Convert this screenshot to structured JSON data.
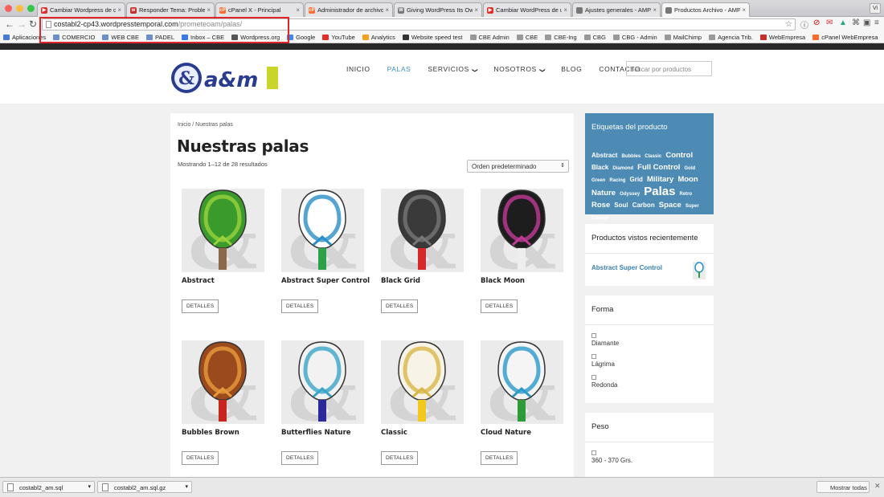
{
  "browser": {
    "tabs": [
      {
        "label": "Cambiar Wordpress de d",
        "color": "#e52d27",
        "glyph": "▶"
      },
      {
        "label": "Responder Tema: Problem",
        "color": "#c4302b",
        "glyph": "w"
      },
      {
        "label": "cPanel X - Principal",
        "color": "#ff6c2c",
        "glyph": "cP"
      },
      {
        "label": "Administrador de archivos",
        "color": "#ff6c2c",
        "glyph": "cP"
      },
      {
        "label": "Giving WordPress Its Own",
        "color": "#777777",
        "glyph": "W"
      },
      {
        "label": "Cambiar WordPress de un",
        "color": "#e52d27",
        "glyph": "▶"
      },
      {
        "label": "Ajustes generales - AMPAD",
        "color": "#777777",
        "glyph": ""
      },
      {
        "label": "Productos Archivo - AMPA",
        "color": "#777777",
        "glyph": ""
      }
    ],
    "profile": "Vi",
    "url_host": "costabl2-cp43.wordpresstemporal.com",
    "url_path": "/prometeoam/palas/",
    "bookmarks": [
      {
        "label": "Aplicaciones",
        "color": "#4a7bd0"
      },
      {
        "label": "COMERCIO",
        "color": "#6b8fc7"
      },
      {
        "label": "WEB CBE",
        "color": "#6b8fc7"
      },
      {
        "label": "PADEL",
        "color": "#6b8fc7"
      },
      {
        "label": "Inbox – CBE",
        "color": "#3b78e7"
      },
      {
        "label": "Wordpress.org",
        "color": "#555555"
      },
      {
        "label": "Google",
        "color": "#4285f4"
      },
      {
        "label": "YouTube",
        "color": "#e52d27"
      },
      {
        "label": "Analytics",
        "color": "#f4a21c"
      },
      {
        "label": "Website speed test",
        "color": "#333333"
      },
      {
        "label": "CBE Admin",
        "color": "#999999"
      },
      {
        "label": "CBE",
        "color": "#999999"
      },
      {
        "label": "CBE-Ing",
        "color": "#999999"
      },
      {
        "label": "CBG",
        "color": "#999999"
      },
      {
        "label": "CBG - Admin",
        "color": "#999999"
      },
      {
        "label": "MailChimp",
        "color": "#999999"
      },
      {
        "label": "Agencia Trib.",
        "color": "#999999"
      },
      {
        "label": "WebEmpresa",
        "color": "#c4302b"
      },
      {
        "label": "cPanel WebEmpresa",
        "color": "#ff6c2c"
      }
    ]
  },
  "site": {
    "nav": [
      {
        "label": "INICIO",
        "caret": ""
      },
      {
        "label": "PALAS",
        "caret": ""
      },
      {
        "label": "SERVICIOS",
        "caret": "❯"
      },
      {
        "label": "NOSOTROS",
        "caret": "❯"
      },
      {
        "label": "BLOG",
        "caret": ""
      },
      {
        "label": "CONTACTO",
        "caret": ""
      }
    ],
    "active_nav": "PALAS",
    "search_placeholder": "Buscar por productos"
  },
  "shop": {
    "breadcrumb": "Inicio / Nuestras palas",
    "title": "Nuestras palas",
    "result_count": "Mostrando 1–12 de 28 resultados",
    "ordering": "Orden predeterminado",
    "details_label": "DETALLES",
    "products": [
      {
        "name": "Abstract",
        "face": "#3a9a2c",
        "accent": "#9ad13d",
        "grip": "#8a6a4a"
      },
      {
        "name": "Abstract Super Control",
        "face": "#ffffff",
        "accent": "#2a8fc8",
        "grip": "#2fa04a"
      },
      {
        "name": "Black Grid",
        "face": "#3a3a3a",
        "accent": "#777777",
        "grip": "#d62a2a"
      },
      {
        "name": "Black Moon",
        "face": "#1d1d1d",
        "accent": "#c03a96",
        "grip": "#eeeeee"
      },
      {
        "name": "Bubbles Brown",
        "face": "#9b4a1e",
        "accent": "#e89a3a",
        "grip": "#c7261f"
      },
      {
        "name": "Butterflies Nature",
        "face": "#f2f2f2",
        "accent": "#3aa4c9",
        "grip": "#2a2a9a"
      },
      {
        "name": "Classic",
        "face": "#f7f3e6",
        "accent": "#d9b64a",
        "grip": "#f2c81c"
      },
      {
        "name": "Cloud Nature",
        "face": "#f5f5f5",
        "accent": "#2c9ac9",
        "grip": "#2f9a3a"
      }
    ]
  },
  "sidebar": {
    "tags_title": "Etiquetas del producto",
    "tags": [
      {
        "t": "Abstract",
        "s": "sm"
      },
      {
        "t": "Bubbles",
        "s": "xs"
      },
      {
        "t": "Classic",
        "s": "xs"
      },
      {
        "t": "Control",
        "s": "md"
      },
      {
        "t": "Black",
        "s": "sm"
      },
      {
        "t": "Diamond",
        "s": "xs"
      },
      {
        "t": "Full Control",
        "s": "md"
      },
      {
        "t": "Gold",
        "s": "xs"
      },
      {
        "t": "Green",
        "s": "xs"
      },
      {
        "t": "Racing",
        "s": "xs"
      },
      {
        "t": "Grid",
        "s": "sm"
      },
      {
        "t": "Military",
        "s": "md"
      },
      {
        "t": "Moon",
        "s": "md"
      },
      {
        "t": "Nature",
        "s": "md"
      },
      {
        "t": "Odyssey",
        "s": "xs"
      },
      {
        "t": "Palas",
        "s": "xl"
      },
      {
        "t": "Retro",
        "s": "xs"
      },
      {
        "t": "Rose",
        "s": "md"
      },
      {
        "t": "Soul",
        "s": "sm"
      },
      {
        "t": "Carbon",
        "s": "sm"
      },
      {
        "t": "Space",
        "s": "md"
      },
      {
        "t": "Super Control",
        "s": "xs"
      }
    ],
    "recent_title": "Productos vistos recientemente",
    "recent_item": "Abstract Super Control",
    "forma_title": "Forma",
    "forma_options": [
      "Diamante",
      "Lágrima",
      "Redonda"
    ],
    "peso_title": "Peso",
    "peso_options": [
      "360 - 370 Grs."
    ]
  },
  "downloads": {
    "items": [
      "costabl2_am.sql",
      "costabl2_am.sql.gz"
    ],
    "show_all": "Mostrar todas"
  }
}
